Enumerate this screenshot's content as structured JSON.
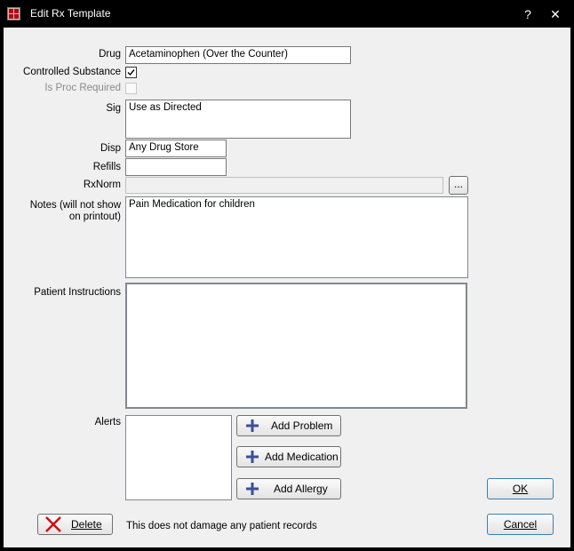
{
  "window": {
    "title": "Edit Rx Template",
    "help_label": "?",
    "close_label": "✕"
  },
  "form": {
    "drug": {
      "label": "Drug",
      "value": "Acetaminophen (Over the Counter)"
    },
    "controlled": {
      "label": "Controlled Substance",
      "checked": true
    },
    "proc": {
      "label": "Is Proc Required",
      "checked": false
    },
    "sig": {
      "label": "Sig",
      "value": "Use as Directed"
    },
    "disp": {
      "label": "Disp",
      "value": "Any Drug Store"
    },
    "refills": {
      "label": "Refills",
      "value": ""
    },
    "rxnorm": {
      "label": "RxNorm",
      "value": "",
      "browse_label": "..."
    },
    "notes": {
      "label_line1": "Notes (will not show",
      "label_line2": "on printout)",
      "value": "Pain Medication for children"
    },
    "patient_instructions": {
      "label": "Patient Instructions",
      "value": ""
    },
    "alerts": {
      "label": "Alerts"
    }
  },
  "buttons": {
    "add_problem": "Add Problem",
    "add_medication": "Add Medication",
    "add_allergy": "Add Allergy",
    "ok": "OK",
    "cancel": "Cancel",
    "delete": "Delete"
  },
  "footer": {
    "delete_note": "This does not damage any patient records"
  },
  "colors": {
    "title_bar": "#000000",
    "plus_icon": "#3a4f9a",
    "delete_icon": "#d01010"
  }
}
